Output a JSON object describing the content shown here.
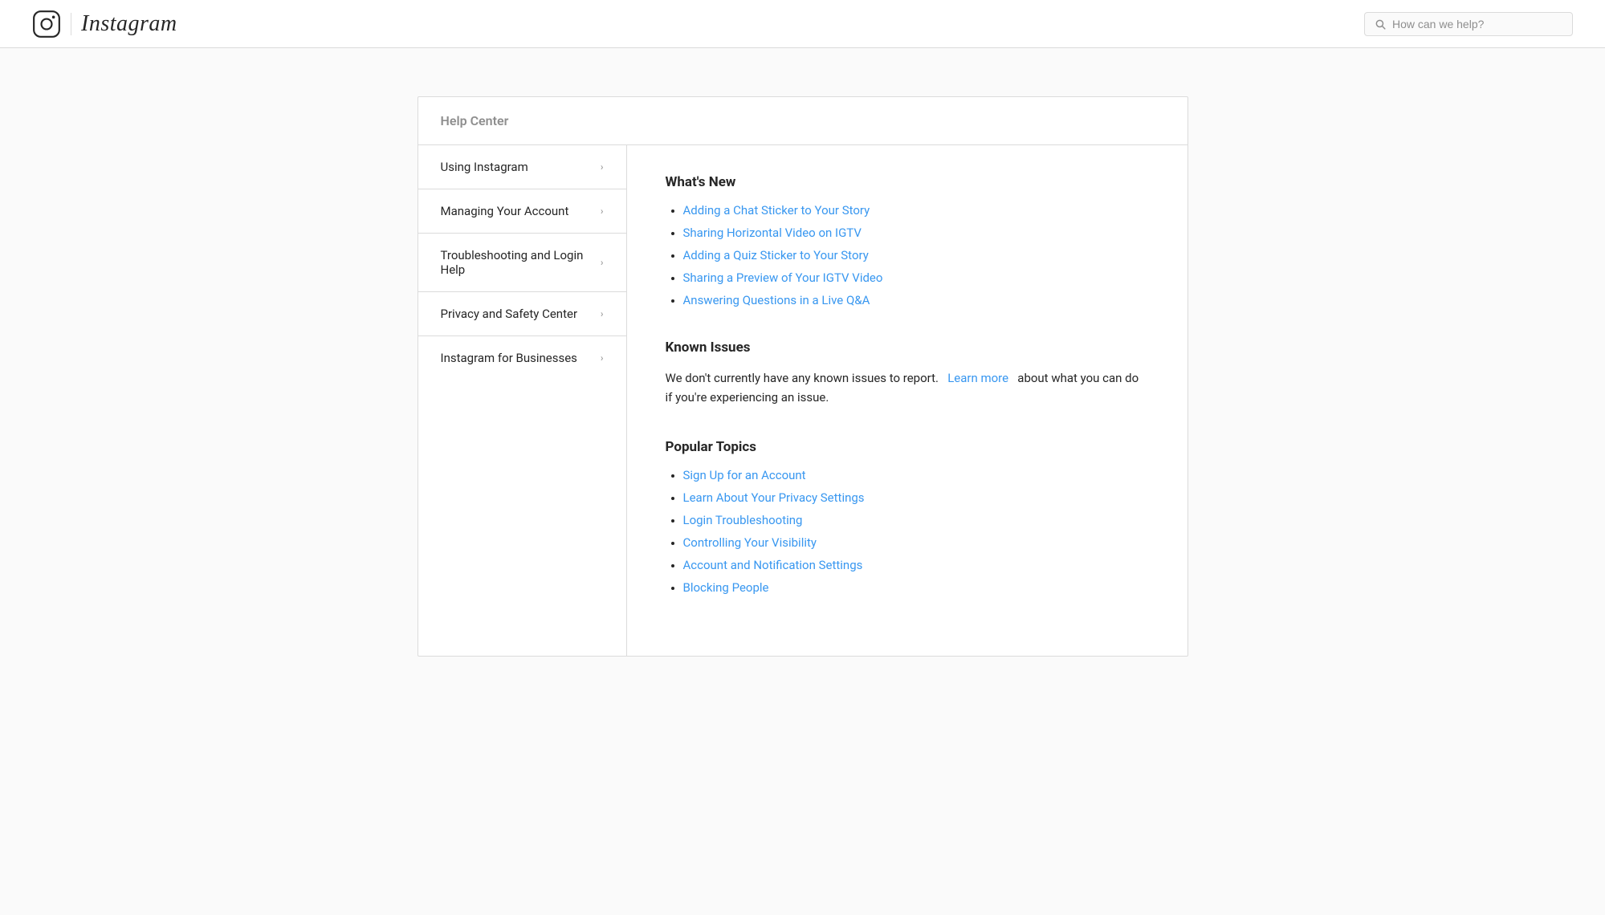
{
  "header": {
    "logo_alt": "Instagram",
    "search_placeholder": "How can we help?"
  },
  "help_center": {
    "title": "Help Center",
    "sidebar": {
      "items": [
        {
          "label": "Using Instagram",
          "id": "using-instagram"
        },
        {
          "label": "Managing Your Account",
          "id": "managing-your-account"
        },
        {
          "label": "Troubleshooting and Login Help",
          "id": "troubleshooting-and-login-help"
        },
        {
          "label": "Privacy and Safety Center",
          "id": "privacy-and-safety-center"
        },
        {
          "label": "Instagram for Businesses",
          "id": "instagram-for-businesses"
        }
      ]
    },
    "main": {
      "whats_new": {
        "title": "What's New",
        "links": [
          {
            "label": "Adding a Chat Sticker to Your Story",
            "href": "#"
          },
          {
            "label": "Sharing Horizontal Video on IGTV",
            "href": "#"
          },
          {
            "label": "Adding a Quiz Sticker to Your Story",
            "href": "#"
          },
          {
            "label": "Sharing a Preview of Your IGTV Video",
            "href": "#"
          },
          {
            "label": "Answering Questions in a Live Q&A",
            "href": "#"
          }
        ]
      },
      "known_issues": {
        "title": "Known Issues",
        "text_before": "We don't currently have any known issues to report.",
        "learn_more_label": "Learn more",
        "learn_more_href": "#",
        "text_after": "about what you can do if you're experiencing an issue."
      },
      "popular_topics": {
        "title": "Popular Topics",
        "links": [
          {
            "label": "Sign Up for an Account",
            "href": "#"
          },
          {
            "label": "Learn About Your Privacy Settings",
            "href": "#"
          },
          {
            "label": "Login Troubleshooting",
            "href": "#"
          },
          {
            "label": "Controlling Your Visibility",
            "href": "#"
          },
          {
            "label": "Account and Notification Settings",
            "href": "#"
          },
          {
            "label": "Blocking People",
            "href": "#"
          }
        ]
      }
    }
  }
}
